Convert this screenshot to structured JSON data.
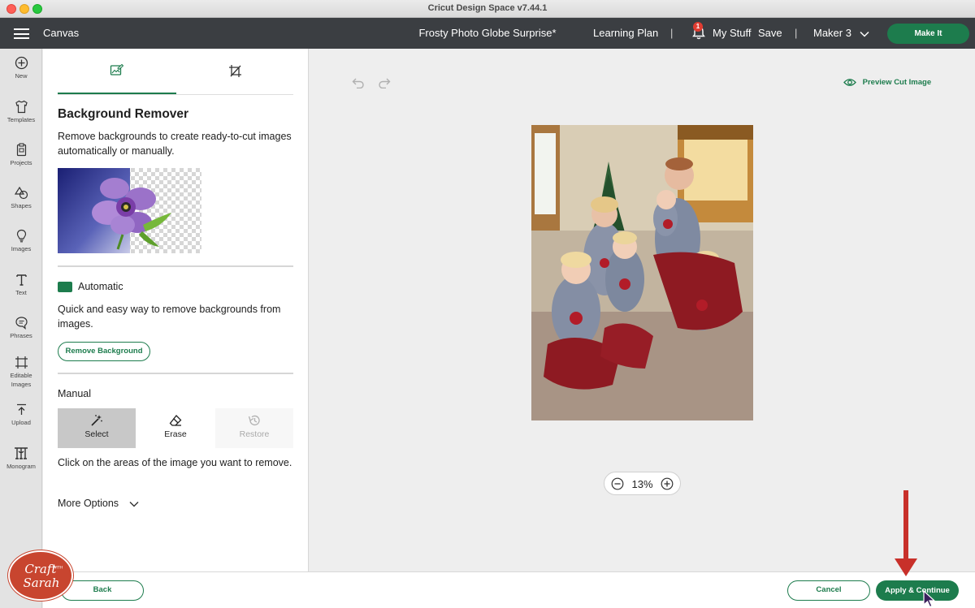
{
  "window": {
    "title": "Cricut Design Space  v7.44.1"
  },
  "header": {
    "canvas_label": "Canvas",
    "project_name": "Frosty Photo Globe Surprise*",
    "learning_plan": "Learning Plan",
    "separator": "|",
    "notification_count": "1",
    "my_stuff": "My Stuff",
    "save": "Save",
    "machine": "Maker 3",
    "make_it": "Make It"
  },
  "rail": {
    "items": [
      {
        "label": "New",
        "icon": "plus-circle-icon"
      },
      {
        "label": "Templates",
        "icon": "shirt-icon"
      },
      {
        "label": "Projects",
        "icon": "clipboard-icon"
      },
      {
        "label": "Shapes",
        "icon": "shapes-icon"
      },
      {
        "label": "Images",
        "icon": "lightbulb-icon"
      },
      {
        "label": "Text",
        "icon": "text-icon"
      },
      {
        "label": "Phrases",
        "icon": "speech-bubble-icon"
      },
      {
        "label": "Editable",
        "label2": "Images",
        "icon": "editable-image-icon"
      },
      {
        "label": "Upload",
        "icon": "upload-icon"
      },
      {
        "label": "Monogram",
        "icon": "monogram-icon"
      }
    ]
  },
  "panel": {
    "tabs": [
      {
        "icon": "edit-image-icon",
        "active": true
      },
      {
        "icon": "crop-icon",
        "active": false
      }
    ],
    "title": "Background Remover",
    "description": "Remove backgrounds to create ready-to-cut images automatically or manually.",
    "automatic": {
      "label": "Automatic",
      "description": "Quick and easy way to remove backgrounds from images.",
      "button": "Remove Background"
    },
    "manual": {
      "label": "Manual",
      "tools": [
        {
          "label": "Select",
          "icon": "magic-wand-icon",
          "state": "selected"
        },
        {
          "label": "Erase",
          "icon": "eraser-icon",
          "state": "enabled"
        },
        {
          "label": "Restore",
          "icon": "restore-icon",
          "state": "disabled"
        }
      ],
      "description": "Click on the areas of the image you want to remove.",
      "more_options": "More Options"
    }
  },
  "canvas": {
    "preview_label": "Preview Cut Image",
    "zoom": "13%"
  },
  "footer": {
    "back": "Back",
    "cancel": "Cancel",
    "apply": "Apply & Continue"
  },
  "watermark": {
    "text": "Craft with Sarah"
  },
  "colors": {
    "brand_green": "#1d7c4d",
    "header_bg": "#3b3e42",
    "arrow_red": "#c8302a"
  }
}
